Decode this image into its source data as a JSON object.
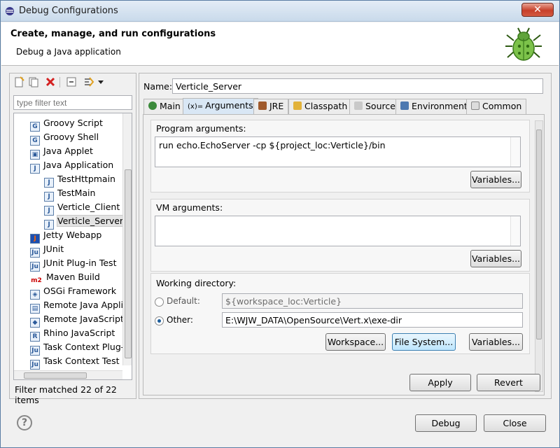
{
  "window": {
    "title": "Debug Configurations",
    "close_glyph": "✕"
  },
  "header": {
    "title": "Create, manage, and run configurations",
    "subtitle": "Debug a Java application"
  },
  "left": {
    "filter_placeholder": "type filter text",
    "tree": [
      {
        "label": "Groovy Script",
        "icon": "groovy-script-icon",
        "indent": 0
      },
      {
        "label": "Groovy Shell",
        "icon": "groovy-shell-icon",
        "indent": 0
      },
      {
        "label": "Java Applet",
        "icon": "java-applet-icon",
        "indent": 0
      },
      {
        "label": "Java Application",
        "icon": "java-application-icon",
        "indent": 0
      },
      {
        "label": "TestHttpmain",
        "icon": "java-config-icon",
        "indent": 1
      },
      {
        "label": "TestMain",
        "icon": "java-config-icon",
        "indent": 1
      },
      {
        "label": "Verticle_Client",
        "icon": "java-config-icon",
        "indent": 1
      },
      {
        "label": "Verticle_Server",
        "icon": "java-config-icon",
        "indent": 1,
        "selected": true
      },
      {
        "label": "Jetty Webapp",
        "icon": "jetty-icon",
        "indent": 0
      },
      {
        "label": "JUnit",
        "icon": "junit-icon",
        "indent": 0
      },
      {
        "label": "JUnit Plug-in Test",
        "icon": "junit-plugin-icon",
        "indent": 0
      },
      {
        "label": "Maven Build",
        "icon": "maven-icon",
        "indent": 0
      },
      {
        "label": "OSGi Framework",
        "icon": "osgi-icon",
        "indent": 0
      },
      {
        "label": "Remote Java Appli",
        "icon": "remote-java-icon",
        "indent": 0
      },
      {
        "label": "Remote JavaScript",
        "icon": "remote-js-icon",
        "indent": 0
      },
      {
        "label": "Rhino JavaScript",
        "icon": "rhino-icon",
        "indent": 0
      },
      {
        "label": "Task Context Plug-",
        "icon": "task-context-icon",
        "indent": 0
      },
      {
        "label": "Task Context Test",
        "icon": "task-context-test-icon",
        "indent": 0
      }
    ],
    "filter_status": "Filter matched 22 of 22 items"
  },
  "right": {
    "name_label": "Name:",
    "name_value": "Verticle_Server",
    "tabs": [
      "Main",
      "Arguments",
      "JRE",
      "Classpath",
      "Source",
      "Environment",
      "Common"
    ],
    "program_args_label": "Program arguments:",
    "program_args_value": "run echo.EchoServer -cp ${project_loc:Verticle}/bin",
    "vm_args_label": "VM arguments:",
    "vm_args_value": "",
    "variables_label": "Variables...",
    "workdir_label": "Working directory:",
    "default_label": "Default:",
    "default_value": "${workspace_loc:Verticle}",
    "other_label": "Other:",
    "other_value": "E:\\WJW_DATA\\OpenSource\\Vert.x\\exe-dir",
    "workspace_btn": "Workspace...",
    "filesystem_btn": "File System...",
    "apply_btn": "Apply",
    "revert_btn": "Revert"
  },
  "footer": {
    "debug_btn": "Debug",
    "close_btn": "Close",
    "help_glyph": "?"
  }
}
